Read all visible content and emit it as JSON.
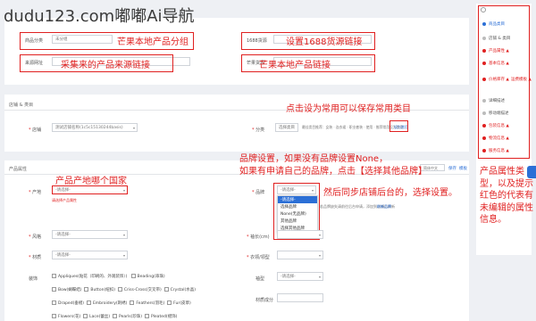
{
  "watermark": "dudu123.com嘟嘟Ai导航",
  "top_fields": {
    "category_label": "商品分类",
    "category_value": "未分组",
    "source_url_label": "来源网址",
    "huoyuan_label": "1688货源",
    "mangsheng_label": "芒果货源"
  },
  "annotations": {
    "a1": "芒果本地产品分组",
    "a2": "设置1688货源链接",
    "a3": "采集来的产品来源链接",
    "a4": "芒果本地产品链接",
    "a5": "点击设为常用可以保存常用类目",
    "a6": "产品产地哪个国家",
    "a7_lines": [
      "品牌设置，如果没有品牌设置None，",
      "如果有申请自己的品牌，点击【选择其他品牌】"
    ],
    "a8": "然后同步店铺后台的，选择设置。",
    "a9_lines": [
      "产品属性类",
      "型，以及提示",
      "红色的代表有",
      "未编辑的属性",
      "信息。"
    ]
  },
  "category_section": {
    "title": "店铺 & 类目",
    "store_label": "店铺",
    "store_value": "测试店铺名称(1c5c15130244basis)",
    "category_label": "分类",
    "category_value": "选择类目",
    "category_hint": "最佳类目推荐：女装 · 连衣裙 · 职业套装 · 使用 · 推荐常用设为常用",
    "set_common": "设为常用"
  },
  "attrs_section": {
    "title": "产品属性",
    "lang_select": "简体中文",
    "save_label": "保存",
    "tmpl_label": "模板",
    "origin_label": "产地",
    "origin_placeholder": "-请选择-",
    "origin_error": "请选择产品属性",
    "brand_label": "品牌",
    "brand_placeholder": "-请选择-",
    "brand_options": [
      "-请选择-",
      "选择品牌",
      "None(无品牌)",
      "其他品牌",
      "选择其他品牌"
    ],
    "brand_hint": "若品牌缺失请前往后台申请，添加到店铺后刷新",
    "brand_refresh": "刷新品牌",
    "style_label": "风格",
    "style_placeholder": "-请选择-",
    "sleeve_label": "袖长(cm)",
    "material_label": "材质",
    "material_placeholder": "-请选择-",
    "collar_label": "衣领/领型",
    "decor_label": "装饰",
    "decor_options": [
      "Appliques(贴花（印刷的、外观装饰）)",
      "Beading(串珠)",
      "Bow(蝴蝶结)",
      "Button(纽扣)",
      "Criss-Cross(交叉带)",
      "Crystal(水晶)",
      "Draped(垂褶)",
      "Embroidery(刺绣)",
      "Feathers(羽毛)",
      "Fur(皮草)",
      "Flowers(花)",
      "Lace(蕾丝)",
      "Pearls(珍珠)",
      "Pleated(褶饰)"
    ],
    "sleeve_type_label": "袖型",
    "fabric_label": "材质成分",
    "sleeve_type_placeholder": "-请选择-"
  },
  "sidebar": {
    "items": [
      {
        "label": "商品类目",
        "color": "#2b6fd6"
      },
      {
        "label": "店铺 & 类目",
        "color": "#2b6fd6"
      },
      {
        "label": "产品属性 ▲",
        "color": "#e02020"
      },
      {
        "label": "基本信息 ▲",
        "color": "#e02020"
      },
      {
        "label": "价格库存 ▲",
        "color": "#e02020"
      },
      {
        "label": "详细描述",
        "color": "#2b6fd6"
      },
      {
        "label": "移动端描述",
        "color": "#2b6fd6"
      },
      {
        "label": "包装信息 ▲",
        "color": "#e02020"
      },
      {
        "label": "物流信息 ▲",
        "color": "#e02020"
      },
      {
        "label": "服务信息 ▲",
        "color": "#e02020"
      }
    ],
    "ship_label": "运费模板 ▲"
  },
  "colors": {
    "accent": "#2b6fd6",
    "warn": "#e02020"
  }
}
